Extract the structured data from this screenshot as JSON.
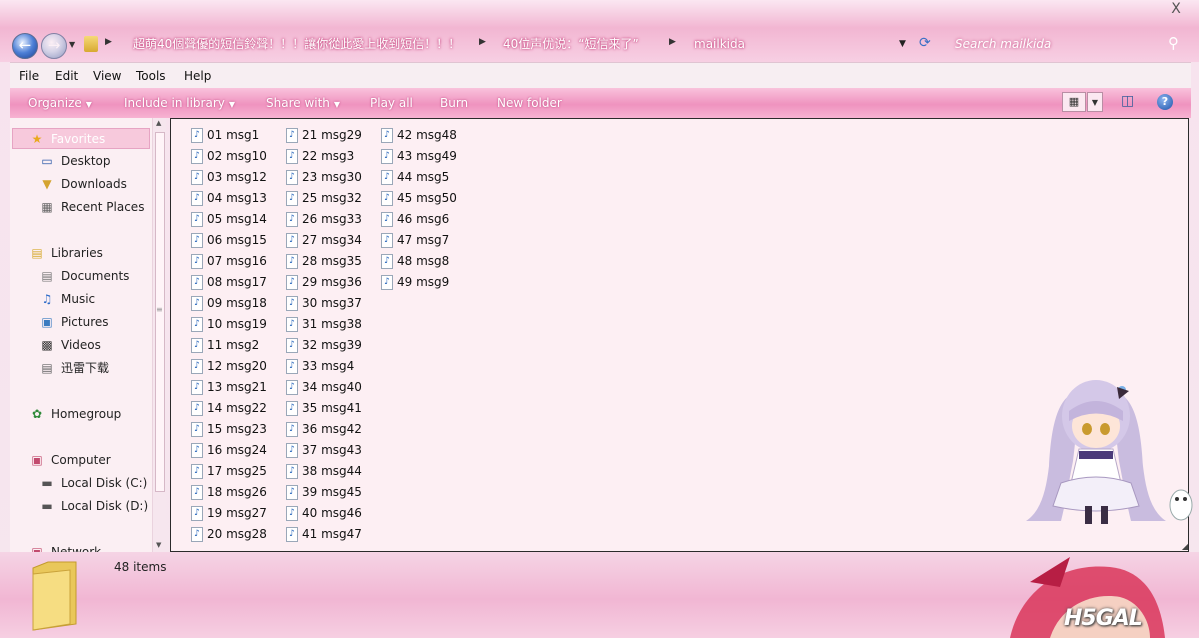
{
  "window": {
    "close_glyph": "X"
  },
  "address_bar": {
    "crumbs": [
      "超萌40個聲優的短信鈴聲！！！讓你從此愛上收到短信！！！",
      "40位声优说：“短信来了”",
      "mailkida"
    ],
    "search_placeholder": "Search mailkida"
  },
  "menubar": {
    "items": [
      "File",
      "Edit",
      "View",
      "Tools",
      "Help"
    ]
  },
  "toolbar": {
    "organize": "Organize",
    "include_in_library": "Include in library",
    "share_with": "Share with",
    "play_all": "Play all",
    "burn": "Burn",
    "new_folder": "New folder"
  },
  "nav": {
    "favorites": "Favorites",
    "desktop": "Desktop",
    "downloads": "Downloads",
    "recent_places": "Recent Places",
    "libraries": "Libraries",
    "documents": "Documents",
    "music": "Music",
    "pictures": "Pictures",
    "videos": "Videos",
    "xunlei": "迅雷下载",
    "homegroup": "Homegroup",
    "computer": "Computer",
    "local_c": "Local Disk (C:)",
    "local_d": "Local Disk (D:)",
    "network": "Network"
  },
  "files": [
    "01 msg1",
    "02 msg10",
    "03 msg12",
    "04 msg13",
    "05 msg14",
    "06 msg15",
    "07 msg16",
    "08 msg17",
    "09 msg18",
    "10 msg19",
    "11 msg2",
    "12 msg20",
    "13 msg21",
    "14 msg22",
    "15 msg23",
    "16 msg24",
    "17 msg25",
    "18 msg26",
    "19 msg27",
    "20 msg28",
    "21 msg29",
    "22 msg3",
    "23 msg30",
    "25 msg32",
    "26 msg33",
    "27 msg34",
    "28 msg35",
    "29 msg36",
    "30 msg37",
    "31 msg38",
    "32 msg39",
    "33 msg4",
    "34 msg40",
    "35 msg41",
    "36 msg42",
    "37 msg43",
    "38 msg44",
    "39 msg45",
    "40 msg46",
    "41 msg47",
    "42 msg48",
    "43 msg49",
    "44 msg5",
    "45 msg50",
    "46 msg6",
    "47 msg7",
    "48 msg8",
    "49 msg9"
  ],
  "details": {
    "item_count": "48 items",
    "watermark": "H5GAL"
  }
}
